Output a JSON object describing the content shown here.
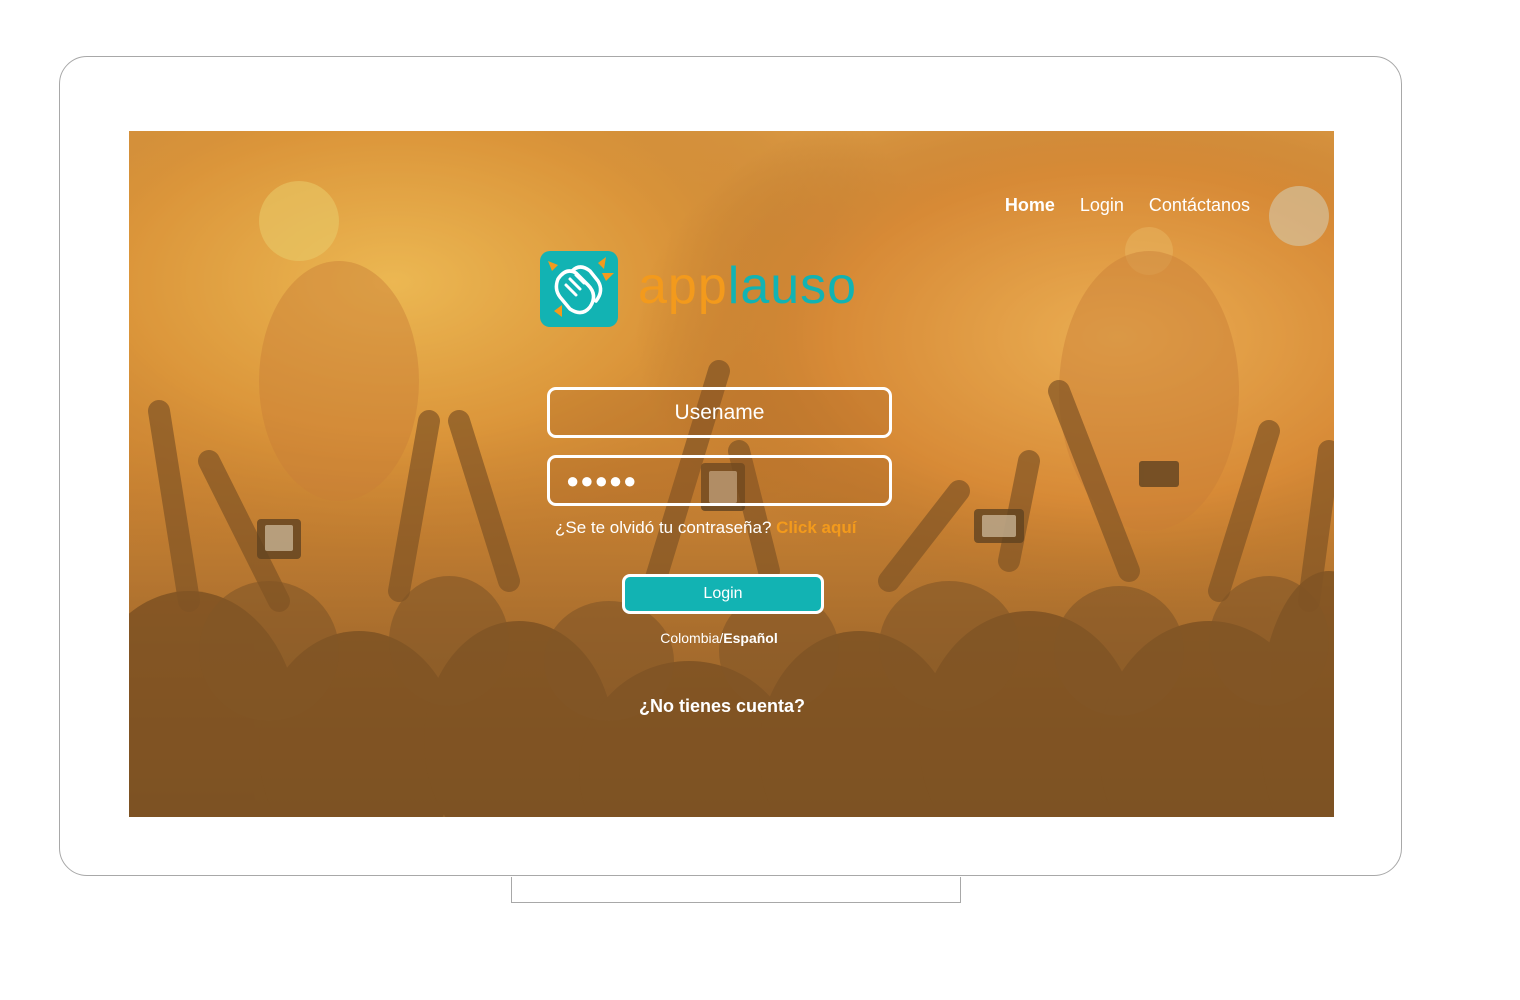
{
  "nav": {
    "items": [
      {
        "label": "Home",
        "active": true
      },
      {
        "label": "Login",
        "active": false
      },
      {
        "label": "Contáctanos",
        "active": false
      }
    ]
  },
  "brand": {
    "name_part1": "app",
    "name_part2": "lauso",
    "icon": "clapping-hands-icon",
    "colors": {
      "orange": "#f39a1c",
      "teal": "#12b3b3"
    }
  },
  "form": {
    "username_placeholder": "Usename",
    "password_value": "●●●●●",
    "forgot_text": "¿Se te olvidó tu contraseña?",
    "forgot_link": "Click aquí",
    "login_label": "Login",
    "locale_country": "Colombia/",
    "locale_language": "Español",
    "signup_text": "¿No tienes cuenta?"
  },
  "background": {
    "description_icon": "concert-crowd-photo"
  }
}
